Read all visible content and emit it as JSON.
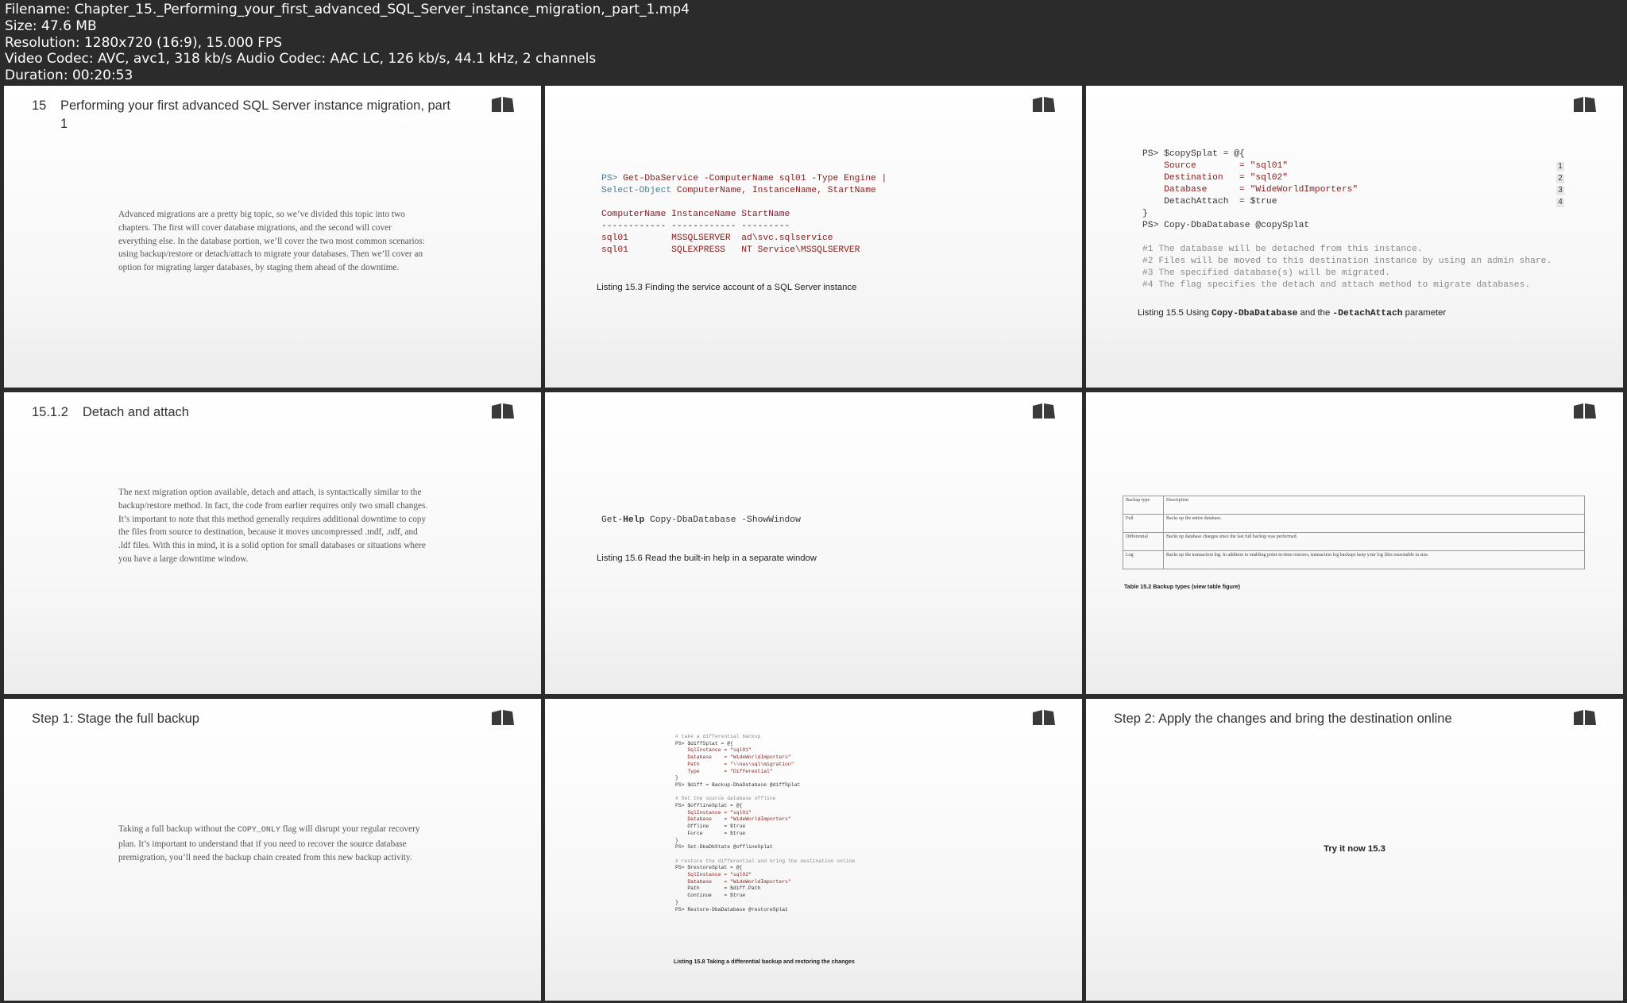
{
  "header": {
    "filename": "Filename: Chapter_15._Performing_your_first_advanced_SQL_Server_instance_migration,_part_1.mp4",
    "size": "Size: 47.6 MB",
    "resolution": "Resolution: 1280x720 (16:9), 15.000 FPS",
    "codec": "Video Codec: AVC, avc1, 318 kb/s Audio Codec: AAC LC, 126 kb/s, 44.1 kHz, 2 channels",
    "duration": "Duration: 00:20:53"
  },
  "icons": {
    "book": "book-icon"
  },
  "colors": {
    "background": "#2b2b2b",
    "header_text": "#ffffff",
    "keyword": "#4a7a8c",
    "string": "#8b1a1a",
    "comment": "#8a8a8a"
  },
  "p1": {
    "num": "15",
    "title": "Performing your first advanced SQL Server instance migration, part 1",
    "body": "Advanced migrations are a pretty big topic, so we’ve divided this topic into two chapters. The first will cover database migrations, and the second will cover everything else. In the database portion, we’ll cover the two most common scenarios: using backup/restore or detach/attach to migrate your databases. Then we’ll cover an option for migrating larger databases, by staging them ahead of the downtime."
  },
  "p2": {
    "prompt": "PS>",
    "cmd_line1": "Get-DbaService -ComputerName sql01 -Type Engine |",
    "cmd_line2a": "Select-Object",
    "cmd_line2b": "ComputerName, InstanceName, StartName",
    "col_headers": "ComputerName InstanceName StartName",
    "divider": "------------ ------------ ---------",
    "row1": "sql01        MSSQLSERVER  ad\\svc.sqlservice",
    "row2": "sql01        SQLEXPRESS   NT Service\\MSSQLSERVER",
    "caption": "Listing 15.3 Finding the service account of a SQL Server instance"
  },
  "p3": {
    "lines": [
      "PS> $copySplat = @{",
      "    Source        = \"sql01\"",
      "    Destination   = \"sql02\"",
      "    Database      = \"WideWorldImporters\"",
      "    DetachAttach  = $true",
      "}",
      "PS> Copy-DbaDatabase @copySplat"
    ],
    "badges": [
      "1",
      "2",
      "3",
      "4"
    ],
    "comments": [
      "#1 The database will be detached from this instance.",
      "#2 Files will be moved to this destination instance by using an admin share.",
      "#3 The specified database(s) will be migrated.",
      "#4 The flag specifies the detach and attach method to migrate databases."
    ],
    "caption_prefix": "Listing 15.5 Using ",
    "caption_code1": "Copy-DbaDatabase",
    "caption_mid": " and the ",
    "caption_code2": "-DetachAttach",
    "caption_suffix": " parameter"
  },
  "p4": {
    "num": "15.1.2",
    "title": "Detach and attach",
    "body": "The next migration option available, detach and attach, is syntactically similar to the backup/restore method. In fact, the code from earlier requires only two small changes. It’s important to note that this method generally requires additional downtime to copy the files from source to destination, because it moves uncompressed .mdf, .ndf, and .ldf files. With this in mind, it is a solid option for small databases or situations where you have a large downtime window."
  },
  "p5": {
    "cmd_a": "Get-",
    "cmd_b": "Help",
    "cmd_c": " Copy-DbaDatabase -ShowWindow",
    "caption": "Listing 15.6 Read the built-in help in a separate window"
  },
  "p6": {
    "headers": [
      "Backup type",
      "Description"
    ],
    "rows": [
      [
        "Full",
        "Backs up the entire database."
      ],
      [
        "Differential",
        "Backs up database changes since the last full backup was performed."
      ],
      [
        "Log",
        "Backs up the transaction log. In addition to enabling point-in-time restores, transaction log backups keep your log files reasonable in size."
      ]
    ],
    "caption": "Table 15.2 Backup types (view table figure)"
  },
  "p7": {
    "title": "Step 1: Stage the full backup",
    "body_a": "Taking a full backup without the ",
    "body_code": "COPY_ONLY",
    "body_b": " flag will disrupt your regular recovery plan. It’s important to understand that if you need to recover the source database premigration, you’ll need the backup chain created from this new backup activity."
  },
  "p8": {
    "lines": [
      "# take a differential backup",
      "PS> $diffSplat = @{",
      "    SqlInstance = \"sql01\"",
      "    Database    = \"WideWorldImporters\"",
      "    Path        = \"\\\\nas\\sql\\migration\"",
      "    Type        = \"Differential\"",
      "}",
      "PS> $diff = Backup-DbaDatabase @diffSplat",
      "",
      "# Set the source database offline",
      "PS> $offlineSplat = @{",
      "    SqlInstance = \"sql01\"",
      "    Database    = \"WideWorldImporters\"",
      "    Offline     = $true",
      "    Force       = $true",
      "}",
      "PS> Set-DbaDbState @offlineSplat",
      "",
      "# restore the differential and bring the destination online",
      "PS> $restoreSplat = @{",
      "    SqlInstance = \"sql02\"",
      "    Database    = \"WideWorldImporters\"",
      "    Path        = $diff.Path",
      "    Continue    = $true",
      "}",
      "PS> Restore-DbaDatabase @restoreSplat"
    ],
    "caption": "Listing 15.8 Taking a differential backup and restoring the changes"
  },
  "p9": {
    "title": "Step 2: Apply the changes and bring the destination online",
    "center": "Try it now 15.3"
  }
}
